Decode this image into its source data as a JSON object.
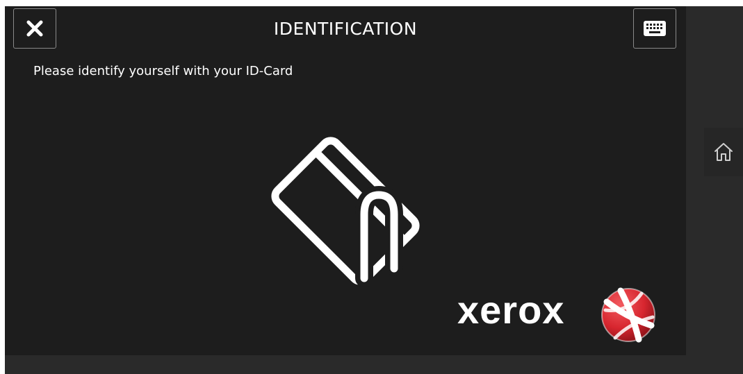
{
  "header": {
    "title": "IDENTIFICATION",
    "close_icon": "close-icon",
    "keyboard_icon": "keyboard-icon"
  },
  "main": {
    "instruction": "Please identify yourself with your ID-Card",
    "illustration_icon": "card-swipe-icon"
  },
  "brand": {
    "name": "xerox",
    "logo_icon": "xerox-sphere-logo",
    "accent_color": "#d7262f"
  },
  "side": {
    "home_icon": "home-icon"
  }
}
